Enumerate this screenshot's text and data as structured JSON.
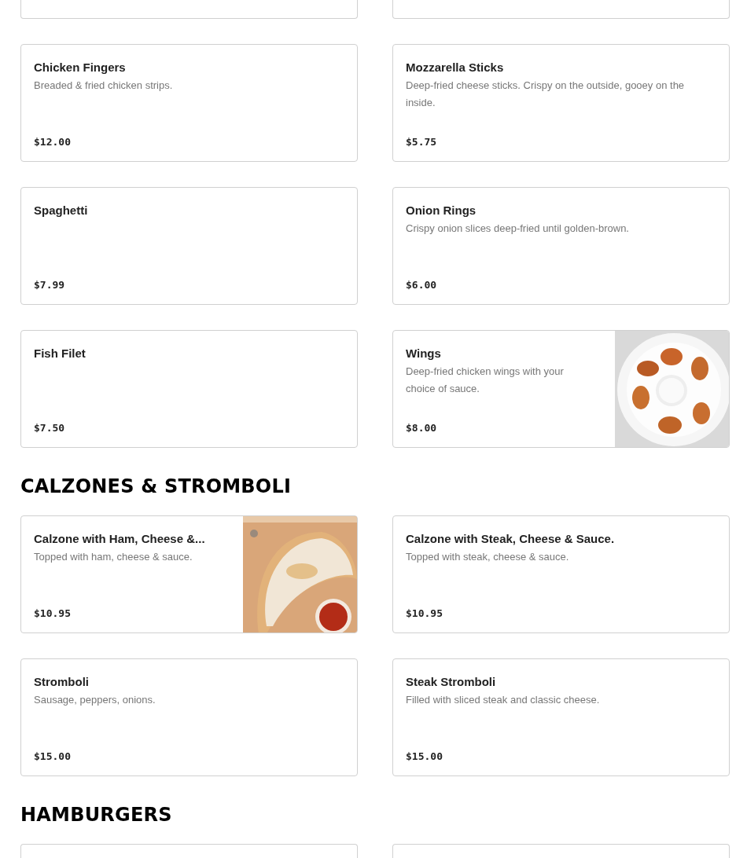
{
  "sections": [
    {
      "items": [
        {
          "name": "Chicken Fingers",
          "description": "Breaded & fried chicken strips.",
          "price": "$12.00"
        },
        {
          "name": "Mozzarella Sticks",
          "description": "Deep-fried cheese sticks. Crispy on the outside, gooey on the inside.",
          "price": "$5.75"
        },
        {
          "name": "Spaghetti",
          "price": "$7.99"
        },
        {
          "name": "Onion Rings",
          "description": "Crispy onion slices deep-fried until golden-brown.",
          "price": "$6.00"
        },
        {
          "name": "Fish Filet",
          "price": "$7.50"
        },
        {
          "name": "Wings",
          "description": "Deep-fried chicken wings with your choice of sauce.",
          "price": "$8.00"
        }
      ]
    },
    {
      "title": "CALZONES & STROMBOLI",
      "items": [
        {
          "name": "Calzone with Ham, Cheese &...",
          "description": "Topped with ham, cheese & sauce.",
          "price": "$10.95"
        },
        {
          "name": "Calzone with Steak, Cheese & Sauce.",
          "description": "Topped with steak, cheese & sauce.",
          "price": "$10.95"
        },
        {
          "name": "Stromboli",
          "description": "Sausage, peppers, onions.",
          "price": "$15.00"
        },
        {
          "name": "Steak Stromboli",
          "description": "Filled with sliced steak and classic cheese.",
          "price": "$15.00"
        }
      ]
    },
    {
      "title": "HAMBURGERS"
    }
  ]
}
